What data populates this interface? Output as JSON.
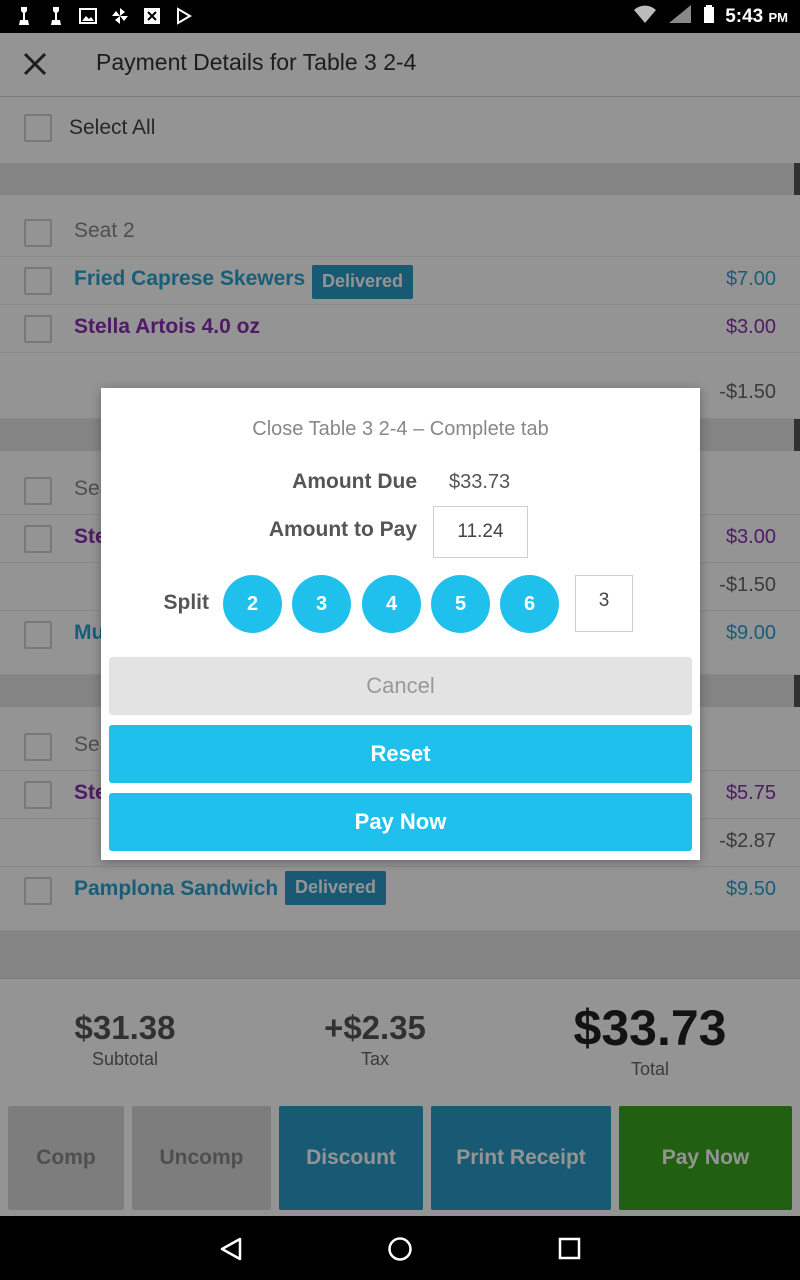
{
  "status_bar": {
    "time": "5:43",
    "ampm": "PM"
  },
  "header": {
    "title": "Payment Details for Table 3 2-4"
  },
  "select_all": {
    "label": "Select All"
  },
  "seats": [
    {
      "label": "Seat 2",
      "items": [
        {
          "name": "Fried Caprese Skewers",
          "badge": "Delivered",
          "price": "$7.00"
        },
        {
          "name": "Stella Artois 4.0 oz",
          "price": "$3.00"
        },
        {
          "price": "-$1.50"
        }
      ]
    },
    {
      "label": "Sea",
      "items": [
        {
          "name": "Ste",
          "price": "$3.00"
        },
        {
          "price": "-$1.50"
        },
        {
          "name": "Mu",
          "price": "$9.00"
        }
      ]
    },
    {
      "label": "Sea",
      "items": [
        {
          "name": "Ste",
          "price": "$5.75"
        },
        {
          "price": "-$2.87"
        },
        {
          "name": "Pamplona Sandwich",
          "badge": "Delivered",
          "price": "$9.50"
        }
      ]
    }
  ],
  "totals": {
    "subtotal_value": "$31.38",
    "subtotal_label": "Subtotal",
    "tax_value": "+$2.35",
    "tax_label": "Tax",
    "total_value": "$33.73",
    "total_label": "Total"
  },
  "actions": {
    "comp": "Comp",
    "uncomp": "Uncomp",
    "discount": "Discount",
    "print_receipt": "Print Receipt",
    "pay_now": "Pay Now"
  },
  "dialog": {
    "title": "Close Table 3 2-4 – Complete tab",
    "amount_due_label": "Amount Due",
    "amount_due_value": "$33.73",
    "amount_to_pay_label": "Amount to Pay",
    "amount_to_pay_value": "11.24",
    "split_label": "Split",
    "split_options": [
      "2",
      "3",
      "4",
      "5",
      "6"
    ],
    "split_custom_value": "3",
    "cancel": "Cancel",
    "reset": "Reset",
    "pay_now": "Pay Now"
  },
  "colors": {
    "accent": "#20c0ec",
    "discount": "#2a9bc7",
    "pay_now": "#3aa51e",
    "item_blue": "#2aa3cf",
    "item_purple": "#8a2db0"
  }
}
